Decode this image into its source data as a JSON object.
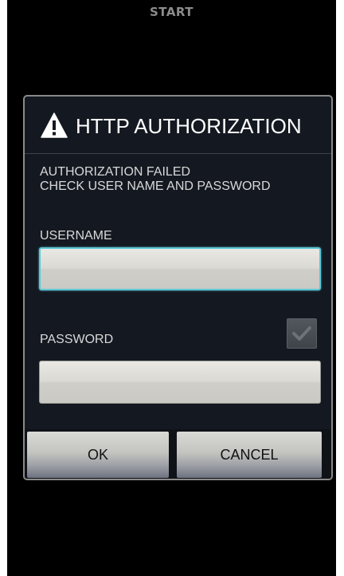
{
  "screen": {
    "title": "START"
  },
  "dialog": {
    "icon": "warning-triangle-icon",
    "title": "HTTP AUTHORIZATION",
    "message_line1": "AUTHORIZATION FAILED",
    "message_line2": "CHECK USER NAME AND PASSWORD",
    "username_label": "USERNAME",
    "username_value": "",
    "password_label": "PASSWORD",
    "password_value": "",
    "show_password_checked": true,
    "ok_label": "OK",
    "cancel_label": "CANCEL"
  },
  "colors": {
    "background": "#000000",
    "dialog_bg": "#141921",
    "dialog_border": "#8a8a8a",
    "focus_outline": "#5fc8d6"
  }
}
